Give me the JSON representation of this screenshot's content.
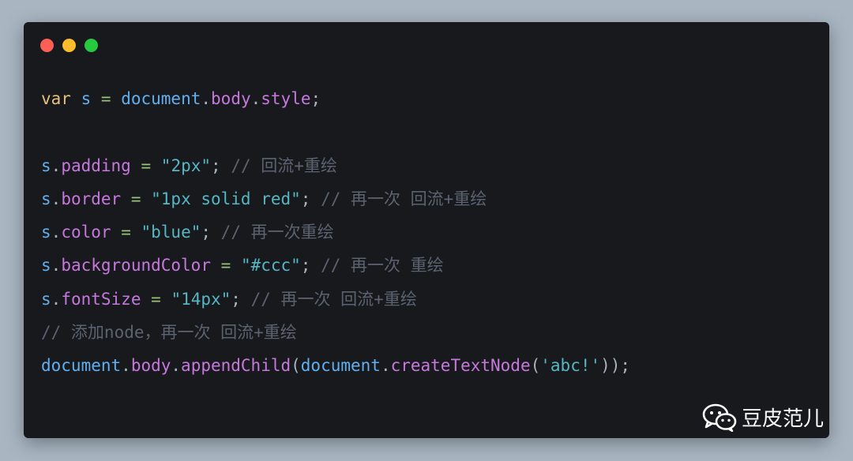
{
  "window": {
    "controls": [
      "close",
      "minimize",
      "maximize"
    ],
    "colors": {
      "close": "#ff5f56",
      "minimize": "#ffbd2e",
      "maximize": "#27c93f",
      "background": "#17191d"
    }
  },
  "code": {
    "line1": {
      "kw": "var",
      "id": "s",
      "eq": "=",
      "obj": "document",
      "dot1": ".",
      "prop1": "body",
      "dot2": ".",
      "prop2": "style",
      "semi": ";"
    },
    "line3": {
      "obj": "s",
      "dot": ".",
      "prop": "padding",
      "eq": "=",
      "str": "\"2px\"",
      "semi": ";",
      "comment": "// 回流+重绘"
    },
    "line4": {
      "obj": "s",
      "dot": ".",
      "prop": "border",
      "eq": "=",
      "str": "\"1px solid red\"",
      "semi": ";",
      "comment": "// 再一次 回流+重绘"
    },
    "line5": {
      "obj": "s",
      "dot": ".",
      "prop": "color",
      "eq": "=",
      "str": "\"blue\"",
      "semi": ";",
      "comment": "// 再一次重绘"
    },
    "line6": {
      "obj": "s",
      "dot": ".",
      "prop": "backgroundColor",
      "eq": "=",
      "str": "\"#ccc\"",
      "semi": ";",
      "comment": "// 再一次 重绘"
    },
    "line7": {
      "obj": "s",
      "dot": ".",
      "prop": "fontSize",
      "eq": "=",
      "str": "\"14px\"",
      "semi": ";",
      "comment": "// 再一次 回流+重绘"
    },
    "line8": {
      "comment": "// 添加node，再一次 回流+重绘"
    },
    "line9": {
      "obj": "document",
      "dot1": ".",
      "prop1": "body",
      "dot2": ".",
      "method": "appendChild",
      "open": "(",
      "obj2": "document",
      "dot3": ".",
      "method2": "createTextNode",
      "open2": "(",
      "str": "'abc!'",
      "close": "));"
    }
  },
  "watermark": {
    "icon": "wechat-icon",
    "text": "豆皮范儿"
  }
}
